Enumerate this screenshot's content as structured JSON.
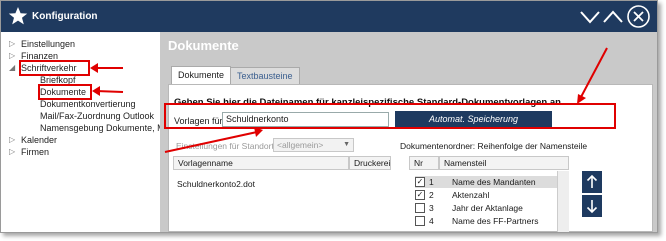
{
  "window": {
    "title": "Konfiguration"
  },
  "tree": {
    "items": [
      {
        "label": "Einstellungen",
        "expander": "▷"
      },
      {
        "label": "Finanzen",
        "expander": "▷"
      },
      {
        "label": "Schriftverkehr",
        "expander": "◢"
      },
      {
        "label": "Briefkopf"
      },
      {
        "label": "Dokumente"
      },
      {
        "label": "Dokumentkonvertierung"
      },
      {
        "label": "Mail/Fax-Zuordnung Outlook"
      },
      {
        "label": "Namensgebung Dokumente, M"
      },
      {
        "label": "Kalender",
        "expander": "▷"
      },
      {
        "label": "Firmen",
        "expander": "▷"
      }
    ]
  },
  "content": {
    "title": "Dokumente",
    "tabs": [
      {
        "label": "Dokumente"
      },
      {
        "label": "Textbausteine"
      }
    ],
    "instruction": "Geben Sie hier die Dateinamen für kanzleispezifische Standard-Dokumentvorlagen an.",
    "vorlage": {
      "label": "Vorlagen für",
      "value": "Schuldnerkonto"
    },
    "save_button": "Automat. Speicherung",
    "storage": {
      "label": "Einstellungen für Standort",
      "value": "<allgemein>"
    },
    "ordner_label": "Dokumentenordner: Reihenfolge der Namensteile",
    "files_table": {
      "headers": [
        "Vorlagenname",
        "Druckereinst"
      ],
      "rows": [
        "Schuldnerkonto2.dot"
      ]
    },
    "names_table": {
      "headers": [
        "Nr",
        "Namensteil"
      ],
      "rows": [
        {
          "nr": "1",
          "name": "Name des Mandanten",
          "checked": true
        },
        {
          "nr": "2",
          "name": "Aktenzahl",
          "checked": true
        },
        {
          "nr": "3",
          "name": "Jahr der Aktanlage",
          "checked": false
        },
        {
          "nr": "4",
          "name": "Name des FF-Partners",
          "checked": false
        }
      ]
    }
  }
}
